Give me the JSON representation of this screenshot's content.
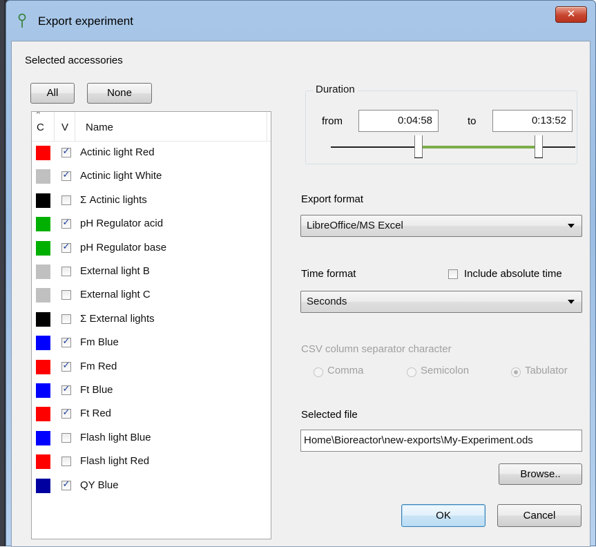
{
  "window": {
    "title": "Export experiment",
    "close_glyph": "✕"
  },
  "accessories": {
    "section_label": "Selected accessories",
    "all_button": "All",
    "none_button": "None",
    "columns": {
      "color": "C",
      "visible": "V",
      "name": "Name",
      "sort_glyph": "^"
    },
    "items": [
      {
        "color": "#ff0000",
        "checked": true,
        "name": "Actinic light Red"
      },
      {
        "color": "#c0c0c0",
        "checked": true,
        "name": "Actinic light White"
      },
      {
        "color": "#000000",
        "checked": false,
        "name": "Σ Actinic lights"
      },
      {
        "color": "#00b000",
        "checked": true,
        "name": "pH Regulator acid"
      },
      {
        "color": "#00b000",
        "checked": true,
        "name": "pH Regulator base"
      },
      {
        "color": "#c0c0c0",
        "checked": false,
        "name": "External light B"
      },
      {
        "color": "#c0c0c0",
        "checked": false,
        "name": "External light C"
      },
      {
        "color": "#000000",
        "checked": false,
        "name": "Σ External lights"
      },
      {
        "color": "#0000ff",
        "checked": true,
        "name": "Fm Blue"
      },
      {
        "color": "#ff0000",
        "checked": true,
        "name": "Fm Red"
      },
      {
        "color": "#0000ff",
        "checked": true,
        "name": "Ft Blue"
      },
      {
        "color": "#ff0000",
        "checked": true,
        "name": "Ft Red"
      },
      {
        "color": "#0000ff",
        "checked": false,
        "name": "Flash light Blue"
      },
      {
        "color": "#ff0000",
        "checked": false,
        "name": "Flash light Red"
      },
      {
        "color": "#0000a0",
        "checked": true,
        "name": "QY Blue"
      }
    ],
    "scroll_up": "▲",
    "scroll_down": "▼"
  },
  "duration": {
    "title": "Duration",
    "from_label": "from",
    "from_value": "0:04:58",
    "to_label": "to",
    "to_value": "0:13:52",
    "range_start_fraction": 0.36,
    "range_end_fraction": 0.85,
    "range_color": "#7aad49"
  },
  "export_format": {
    "label": "Export format",
    "value": "LibreOffice/MS Excel"
  },
  "time_format": {
    "label": "Time format",
    "value": "Seconds",
    "include_absolute_label": "Include absolute time",
    "include_absolute_checked": false
  },
  "csv": {
    "label": "CSV column separator character",
    "options": [
      {
        "label": "Comma",
        "selected": false
      },
      {
        "label": "Semicolon",
        "selected": false
      },
      {
        "label": "Tabulator",
        "selected": true
      }
    ],
    "enabled": false
  },
  "selected_file": {
    "label": "Selected file",
    "value": "Home\\Bioreactor\\new-exports\\My-Experiment.ods",
    "browse_button": "Browse.."
  },
  "dialog_buttons": {
    "ok": "OK",
    "cancel": "Cancel"
  }
}
